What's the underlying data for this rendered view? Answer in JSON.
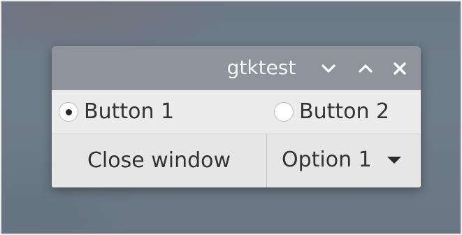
{
  "window": {
    "title": "gtktest"
  },
  "titlebar": {
    "minimize_icon": "chevron-down-icon",
    "maximize_icon": "chevron-up-icon",
    "close_icon": "close-icon"
  },
  "radios": {
    "button1": {
      "label": "Button 1",
      "selected": true
    },
    "button2": {
      "label": "Button 2",
      "selected": false
    }
  },
  "actions": {
    "close_window_label": "Close window"
  },
  "combo": {
    "selected": "Option 1",
    "arrow_icon": "caret-down-icon"
  },
  "colors": {
    "titlebar": "#8f949c",
    "window_bg": "#e4e4e4",
    "text": "#333333",
    "desktop": "#6f7c89"
  }
}
